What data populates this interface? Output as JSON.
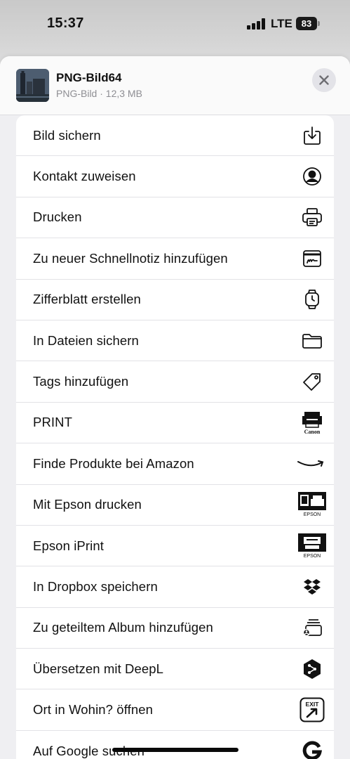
{
  "status": {
    "time": "15:37",
    "network": "LTE",
    "battery": "83"
  },
  "file": {
    "title": "PNG-Bild64",
    "subtitle": "PNG-Bild · 12,3 MB"
  },
  "actions": [
    {
      "label": "Bild sichern",
      "icon": "save-image-icon"
    },
    {
      "label": "Kontakt zuweisen",
      "icon": "person-circle-icon"
    },
    {
      "label": "Drucken",
      "icon": "printer-icon"
    },
    {
      "label": "Zu neuer Schnellnotiz hinzufügen",
      "icon": "quick-note-icon"
    },
    {
      "label": "Zifferblatt erstellen",
      "icon": "watch-icon"
    },
    {
      "label": "In Dateien sichern",
      "icon": "folder-icon"
    },
    {
      "label": "Tags hinzufügen",
      "icon": "tag-icon"
    },
    {
      "label": "PRINT",
      "icon": "canon-print-icon",
      "icon_text": "Canon"
    },
    {
      "label": "Finde Produkte bei Amazon",
      "icon": "amazon-smile-icon"
    },
    {
      "label": "Mit Epson drucken",
      "icon": "epson-print-icon",
      "icon_text": "EPSON"
    },
    {
      "label": "Epson iPrint",
      "icon": "epson-iprint-icon",
      "icon_text": "EPSON"
    },
    {
      "label": "In Dropbox speichern",
      "icon": "dropbox-icon"
    },
    {
      "label": "Zu geteiltem Album hinzufügen",
      "icon": "shared-album-icon"
    },
    {
      "label": "Übersetzen mit DeepL",
      "icon": "deepl-icon"
    },
    {
      "label": "Ort in Wohin? öffnen",
      "icon": "exit-sign-icon",
      "icon_text": "EXIT"
    },
    {
      "label": "Auf Google suchen",
      "icon": "google-g-icon"
    }
  ]
}
